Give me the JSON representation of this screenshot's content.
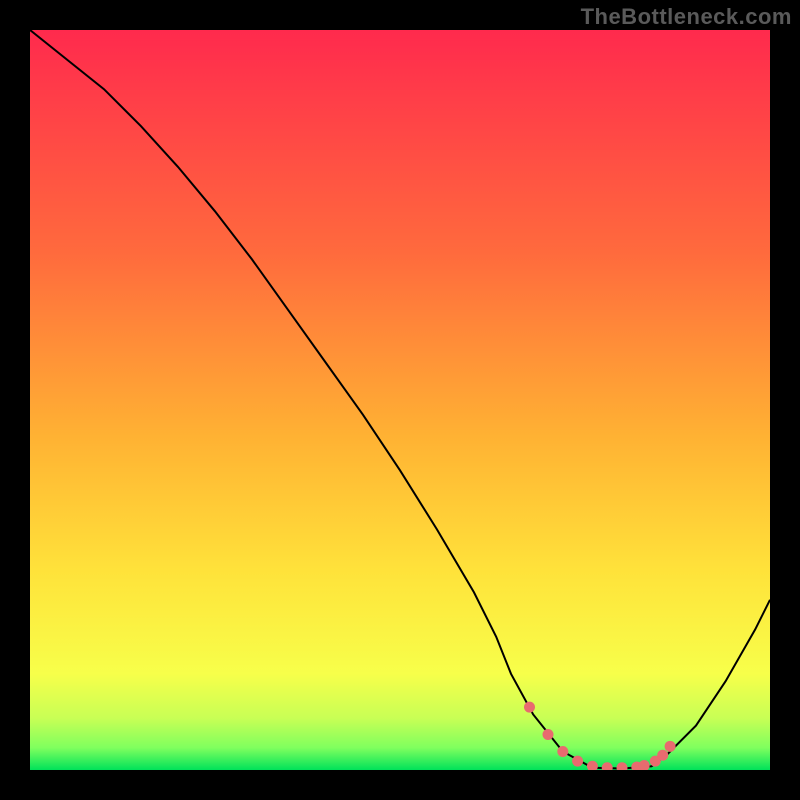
{
  "watermark": {
    "text": "TheBottleneck.com"
  },
  "chart_data": {
    "type": "line",
    "title": "",
    "xlabel": "",
    "ylabel": "",
    "xlim": [
      0,
      100
    ],
    "ylim": [
      0,
      100
    ],
    "background_gradient_stops": [
      {
        "offset": 0,
        "color": "#ff2a4d"
      },
      {
        "offset": 0.3,
        "color": "#ff6a3d"
      },
      {
        "offset": 0.55,
        "color": "#ffb233"
      },
      {
        "offset": 0.73,
        "color": "#ffe23a"
      },
      {
        "offset": 0.87,
        "color": "#f7ff4a"
      },
      {
        "offset": 0.93,
        "color": "#c8ff55"
      },
      {
        "offset": 0.97,
        "color": "#7fff5e"
      },
      {
        "offset": 1.0,
        "color": "#00e25a"
      }
    ],
    "series": [
      {
        "name": "bottleneck-curve",
        "type": "line",
        "color": "#000000",
        "x": [
          0,
          5,
          10,
          15,
          20,
          25,
          30,
          35,
          40,
          45,
          50,
          55,
          60,
          63,
          65,
          68,
          72,
          76,
          80,
          84,
          86,
          90,
          94,
          98,
          100
        ],
        "y": [
          100,
          96,
          92,
          87,
          81.5,
          75.5,
          69,
          62,
          55,
          48,
          40.5,
          32.5,
          24,
          18,
          13,
          7.5,
          2.5,
          0.3,
          0.2,
          0.5,
          2,
          6,
          12,
          19,
          23
        ]
      },
      {
        "name": "optimal-zone-markers",
        "type": "scatter",
        "color": "#e86b6f",
        "marker_radius_px": 5.5,
        "x": [
          67.5,
          70,
          72,
          74,
          76,
          78,
          80,
          82,
          83,
          84.5,
          85.5,
          86.5
        ],
        "y": [
          8.5,
          4.8,
          2.5,
          1.2,
          0.5,
          0.3,
          0.3,
          0.4,
          0.6,
          1.2,
          2.0,
          3.2
        ]
      }
    ]
  }
}
